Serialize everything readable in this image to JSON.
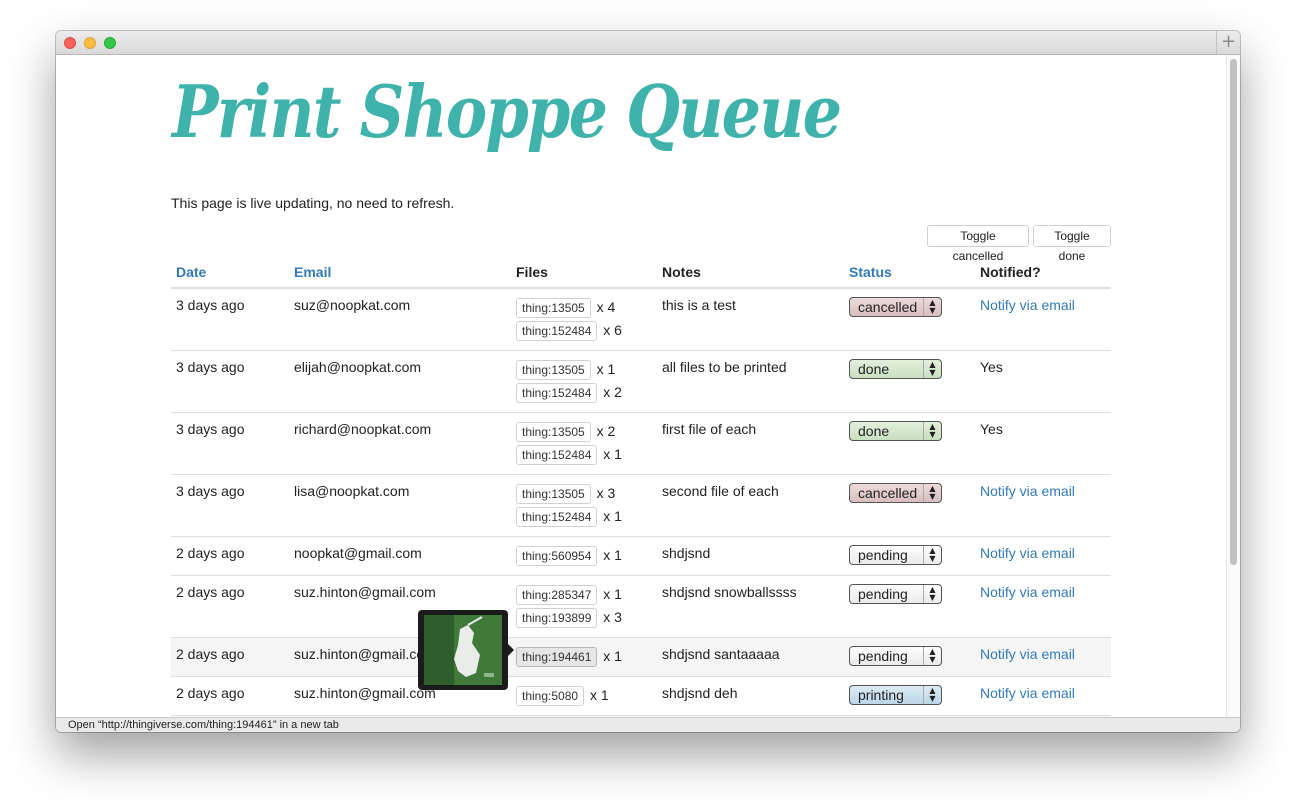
{
  "page": {
    "title": "Print Shoppe Queue",
    "subtitle": "This page is live updating, no need to refresh."
  },
  "toolbar": {
    "toggle_cancelled": "Toggle cancelled",
    "toggle_done": "Toggle done"
  },
  "table": {
    "headers": {
      "date": "Date",
      "email": "Email",
      "files": "Files",
      "notes": "Notes",
      "status": "Status",
      "notified": "Notified?"
    },
    "rows": [
      {
        "date": "3 days ago",
        "email": "suz@noopkat.com",
        "files": [
          {
            "id": "thing:13505",
            "qty": "x 4"
          },
          {
            "id": "thing:152484",
            "qty": "x 6"
          }
        ],
        "notes": "this is a test",
        "status": "cancelled",
        "notified": "Notify via email"
      },
      {
        "date": "3 days ago",
        "email": "elijah@noopkat.com",
        "files": [
          {
            "id": "thing:13505",
            "qty": "x 1"
          },
          {
            "id": "thing:152484",
            "qty": "x 2"
          }
        ],
        "notes": "all files to be printed",
        "status": "done",
        "notified": "Yes"
      },
      {
        "date": "3 days ago",
        "email": "richard@noopkat.com",
        "files": [
          {
            "id": "thing:13505",
            "qty": "x 2"
          },
          {
            "id": "thing:152484",
            "qty": "x 1"
          }
        ],
        "notes": "first file of each",
        "status": "done",
        "notified": "Yes"
      },
      {
        "date": "3 days ago",
        "email": "lisa@noopkat.com",
        "files": [
          {
            "id": "thing:13505",
            "qty": "x 3"
          },
          {
            "id": "thing:152484",
            "qty": "x 1"
          }
        ],
        "notes": "second file of each",
        "status": "cancelled",
        "notified": "Notify via email"
      },
      {
        "date": "2 days ago",
        "email": "noopkat@gmail.com",
        "files": [
          {
            "id": "thing:560954",
            "qty": "x 1"
          }
        ],
        "notes": "shdjsnd",
        "status": "pending",
        "notified": "Notify via email"
      },
      {
        "date": "2 days ago",
        "email": "suz.hinton@gmail.com",
        "files": [
          {
            "id": "thing:285347",
            "qty": "x 1"
          },
          {
            "id": "thing:193899",
            "qty": "x 3"
          }
        ],
        "notes": "shdjsnd snowballssss",
        "status": "pending",
        "notified": "Notify via email"
      },
      {
        "date": "2 days ago",
        "email": "suz.hinton@gmail.com",
        "files": [
          {
            "id": "thing:194461",
            "qty": "x 1"
          }
        ],
        "notes": "shdjsnd santaaaaa",
        "status": "pending",
        "notified": "Notify via email"
      },
      {
        "date": "2 days ago",
        "email": "suz.hinton@gmail.com",
        "files": [
          {
            "id": "thing:5080",
            "qty": "x 1"
          }
        ],
        "notes": "shdjsnd deh",
        "status": "printing",
        "notified": "Notify via email"
      }
    ]
  },
  "statusbar": {
    "text": "Open “http://thingiverse.com/thing:194461” in a new tab"
  },
  "colors": {
    "title": "#3fb3ab",
    "link": "#337ab7",
    "cancelled": "#d9bfbf",
    "done": "#c9e0bf",
    "printing": "#bcd6e8"
  },
  "icons": {
    "new_tab": "plus-icon",
    "select_arrows": "updown-arrows-icon"
  }
}
